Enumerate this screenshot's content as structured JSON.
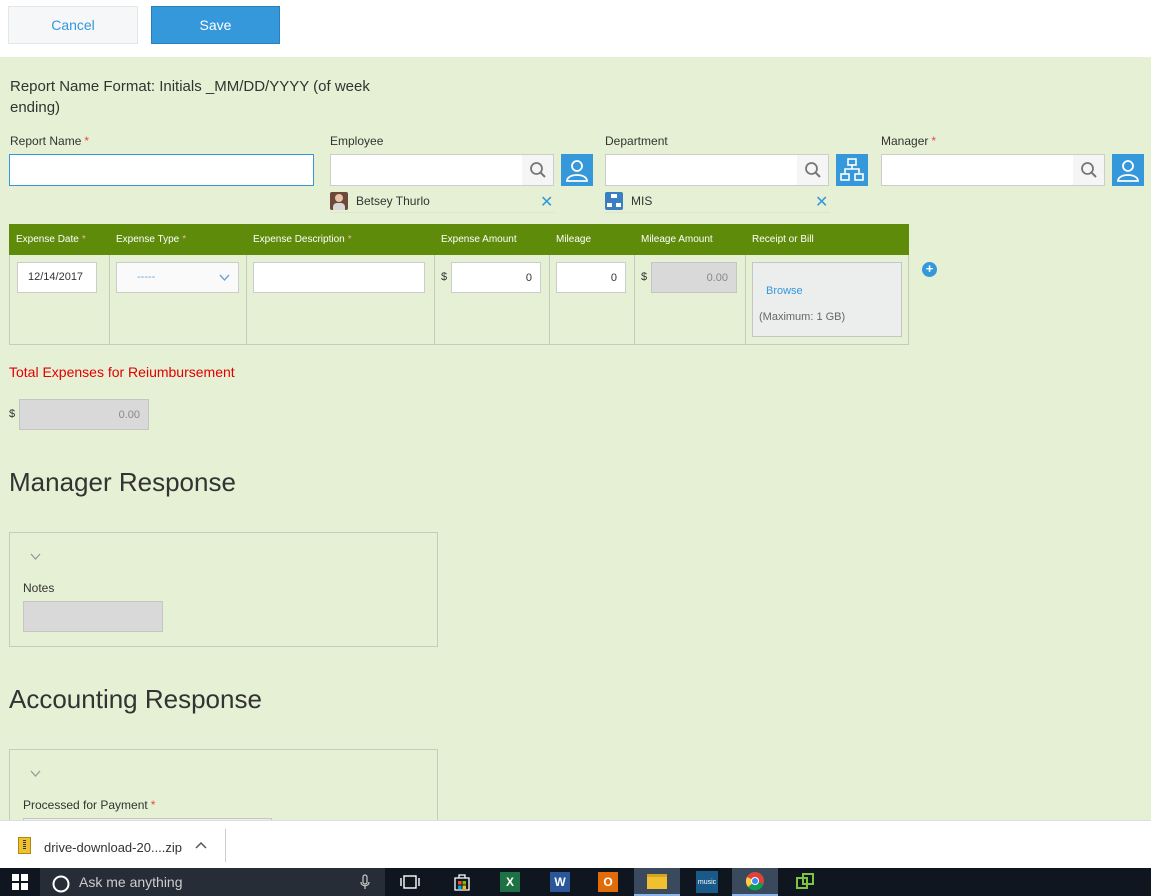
{
  "toolbar": {
    "cancel_label": "Cancel",
    "save_label": "Save"
  },
  "format_note": "Report Name Format: Initials _MM/DD/YYYY (of week ending)",
  "fields": {
    "report_name": {
      "label": "Report Name",
      "required": "*",
      "value": ""
    },
    "employee": {
      "label": "Employee",
      "selected": "Betsey Thurlo"
    },
    "department": {
      "label": "Department",
      "selected": "MIS"
    },
    "manager": {
      "label": "Manager",
      "required": "*"
    }
  },
  "expense_table": {
    "headers": [
      "Expense Date",
      "Expense Type",
      "Expense Description",
      "Expense Amount",
      "Mileage",
      "Mileage Amount",
      "Receipt or Bill"
    ],
    "required_mark": "*",
    "row": {
      "date": "12/14/2017",
      "type": "-----",
      "description": "",
      "currency": "$",
      "amount": "0",
      "mileage": "0",
      "mileage_amount": "0.00",
      "browse_label": "Browse",
      "max_note": "(Maximum: 1 GB)"
    }
  },
  "total": {
    "label": "Total Expenses for Reiumbursement",
    "currency": "$",
    "value": "0.00"
  },
  "manager_response": {
    "title": "Manager Response",
    "notes_label": "Notes"
  },
  "accounting_response": {
    "title": "Accounting Response",
    "processed_label": "Processed for Payment",
    "required": "*"
  },
  "download": {
    "filename": "drive-download-20....zip"
  },
  "taskbar": {
    "search_placeholder": "Ask me anything"
  },
  "colors": {
    "accent": "#3498db",
    "page_bg": "#e6f0d4",
    "table_header": "#5f8b0b",
    "total_label": "#e00000"
  }
}
